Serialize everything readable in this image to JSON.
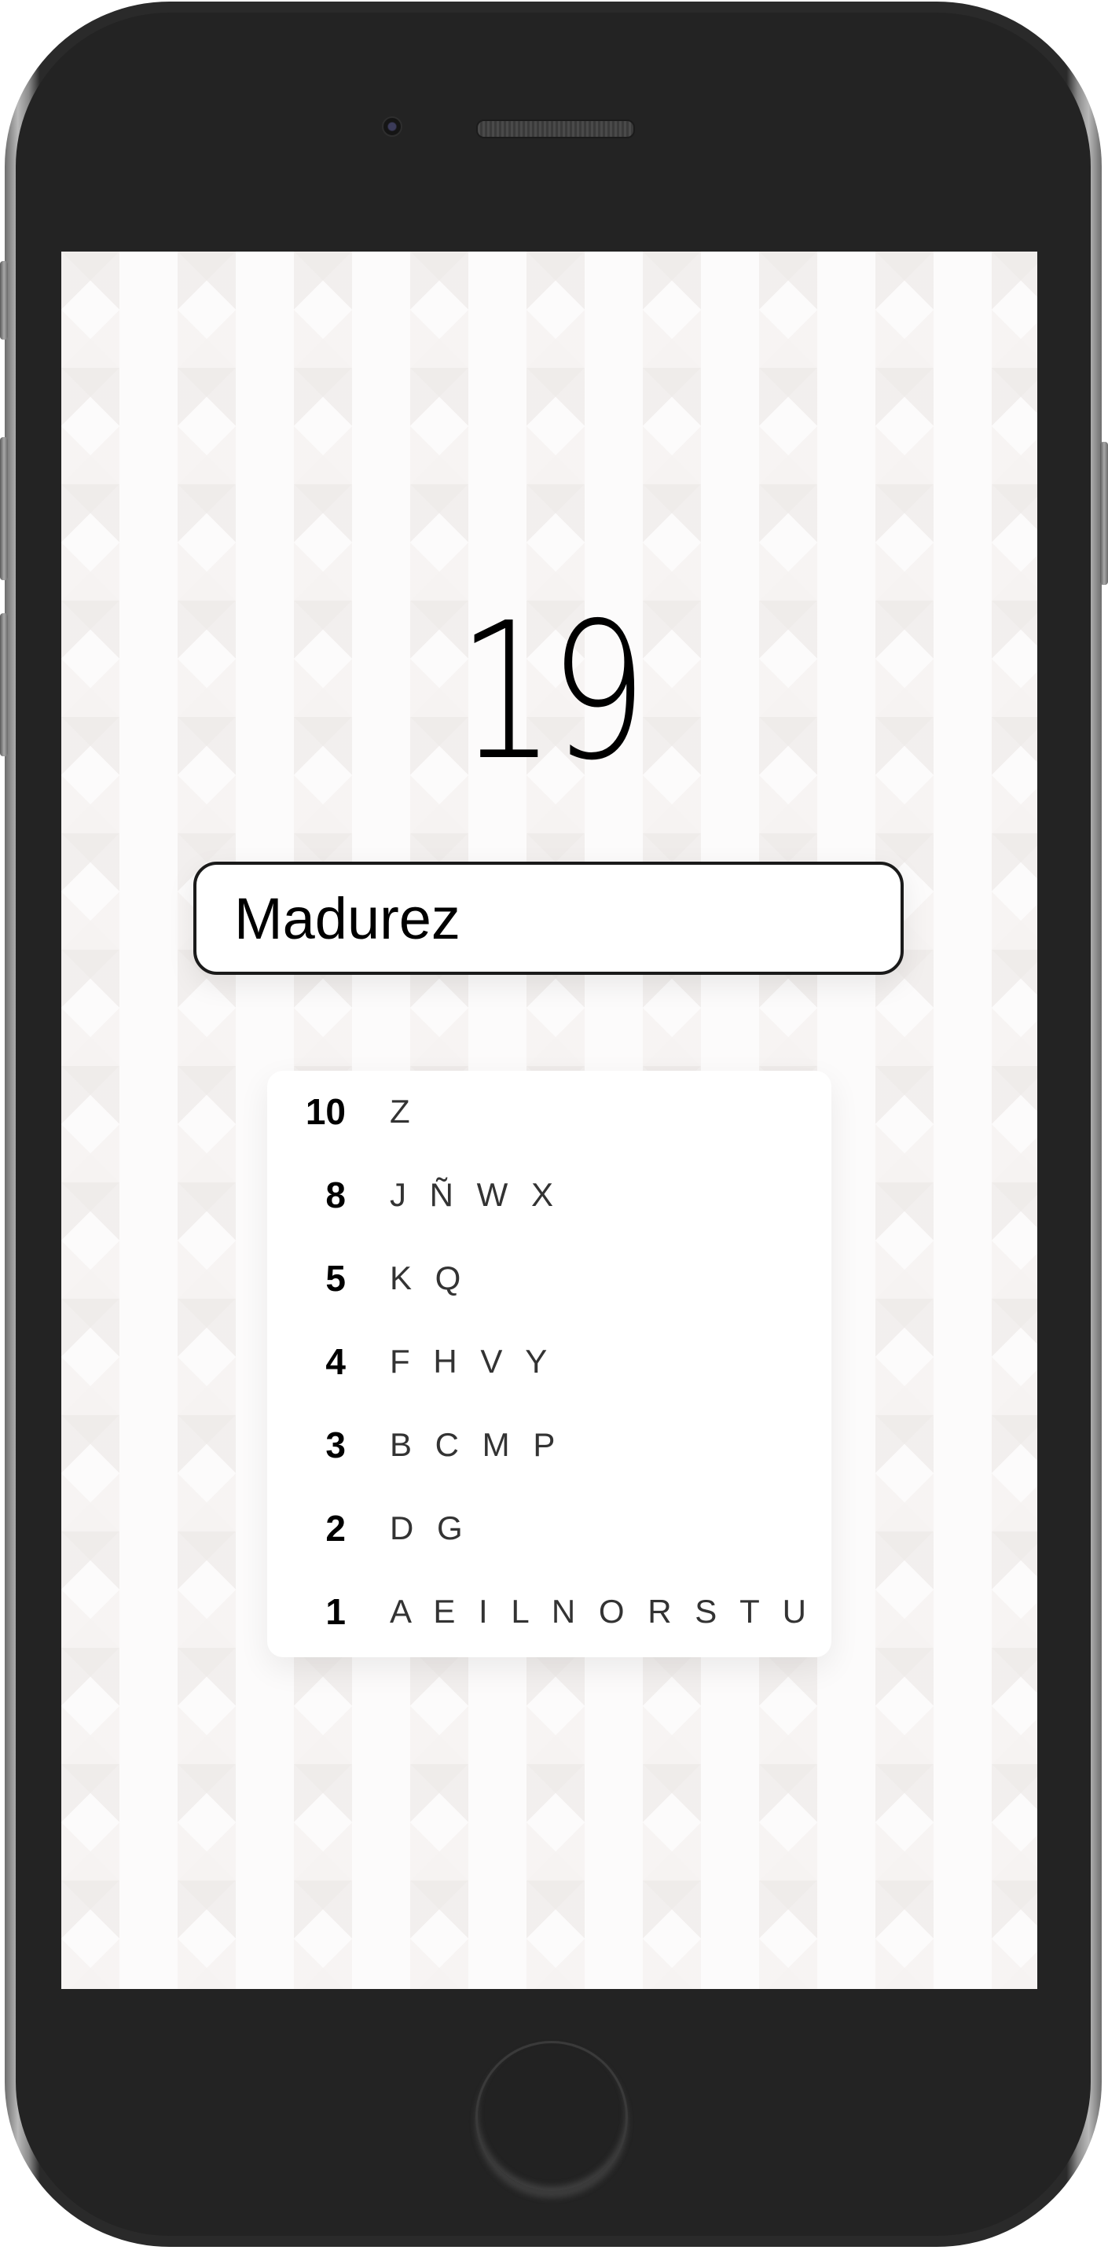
{
  "game": {
    "score": "19",
    "word": "Madurez"
  },
  "letter_values": [
    {
      "points": "10",
      "letters": "Z"
    },
    {
      "points": "8",
      "letters": "J Ñ W X"
    },
    {
      "points": "5",
      "letters": "K Q"
    },
    {
      "points": "4",
      "letters": "F H V Y"
    },
    {
      "points": "3",
      "letters": "B C M P"
    },
    {
      "points": "2",
      "letters": "D G"
    },
    {
      "points": "1",
      "letters": "A E I L N O R S T U"
    }
  ]
}
